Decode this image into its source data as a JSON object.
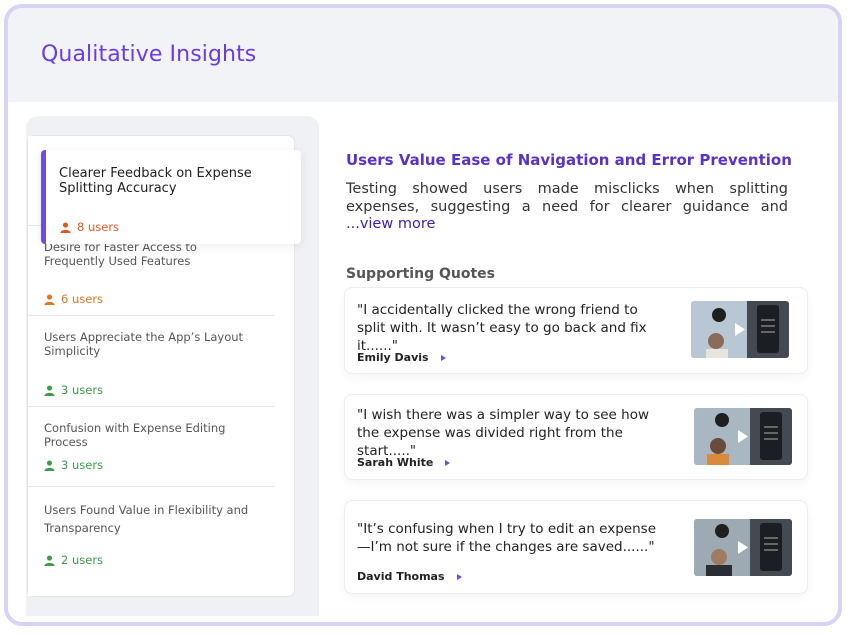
{
  "header": {
    "title": "Qualitative Insights"
  },
  "insights": [
    {
      "label": "Clearer Feedback on Expense Splitting Accuracy",
      "count": "8 users",
      "color": "#e5571f"
    },
    {
      "label": "Desire for Faster Access to Frequently Used Features",
      "count": "6 users",
      "color": "#e07520"
    },
    {
      "label": "Users Appreciate the App’s Layout Simplicity",
      "count": "3 users",
      "color": "#3d9b4a"
    },
    {
      "label": "Confusion with Expense Editing Process",
      "count": "3 users",
      "color": "#3d9b4a"
    },
    {
      "label": "Users Found Value in Flexibility and Transparency",
      "count": "2 users",
      "color": "#3d9b4a"
    }
  ],
  "detail": {
    "title": "Users Value Ease of Navigation and Error Prevention",
    "description": "Testing showed users made misclicks when splitting expenses, suggesting a need for clearer guidance and easier error co",
    "view_more": "...view more",
    "quotes_heading": "Supporting Quotes"
  },
  "quotes": [
    {
      "text": "\"I accidentally clicked the wrong friend to split with. It wasn’t easy to go back and fix it......\"",
      "author": "Emily Davis"
    },
    {
      "text": "\"I wish there was a simpler way to see how the expense was divided right from the start.....\"",
      "author": "Sarah White"
    },
    {
      "text": "\"It’s confusing when I try to edit an expense —I’m not sure if the changes are saved......\"",
      "author": "David Thomas"
    }
  ],
  "colors": {
    "accent": "#6a3ce4",
    "accent_dark": "#5a32c8",
    "orange": "#e5571f",
    "green": "#3d9b4a"
  },
  "icons": [
    "user-icon",
    "play-icon",
    "headphones-icon"
  ]
}
